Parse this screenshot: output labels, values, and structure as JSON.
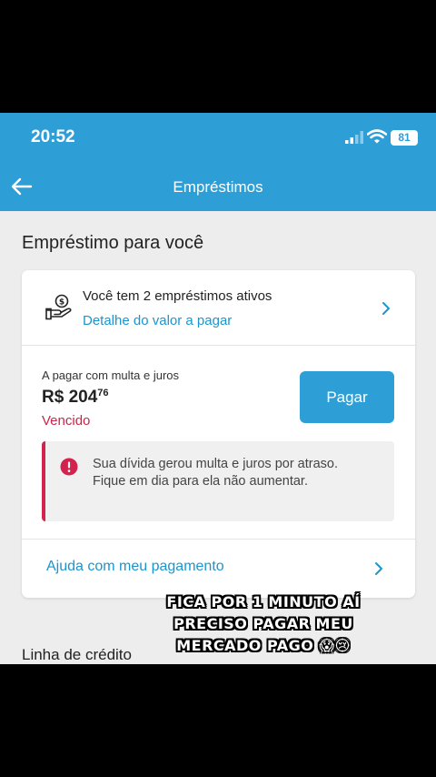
{
  "status_bar": {
    "time": "20:52",
    "battery": "81"
  },
  "header": {
    "title": "Empréstimos"
  },
  "section_title": "Empréstimo para você",
  "loans": {
    "count_text": "Você tem 2 empréstimos ativos",
    "detail_link": "Detalhe do valor a pagar"
  },
  "payment": {
    "due_label": "A pagar com multa e juros",
    "amount_main": "R$ 204",
    "amount_cents": "76",
    "status": "Vencido",
    "pay_button": "Pagar"
  },
  "alert": {
    "text": "Sua dívida gerou multa e juros por atraso. Fique em dia para ela não aumentar."
  },
  "help": {
    "label": "Ajuda com meu pagamento"
  },
  "credit_line_title": "Linha de crédito",
  "caption": {
    "line1": "FICA POR 1 MINUTO AÍ",
    "line2": "PRECISO PAGAR MEU",
    "line3": "MERCADO PAGO 😱😢"
  },
  "colors": {
    "brand_blue": "#2d9fd6",
    "link_blue": "#1b95cf",
    "overdue_red": "#c8264b",
    "alert_red": "#d1234d"
  },
  "icons": [
    "back-arrow",
    "money-hand",
    "chevron-right",
    "error-circle",
    "signal-bars",
    "wifi",
    "battery"
  ]
}
